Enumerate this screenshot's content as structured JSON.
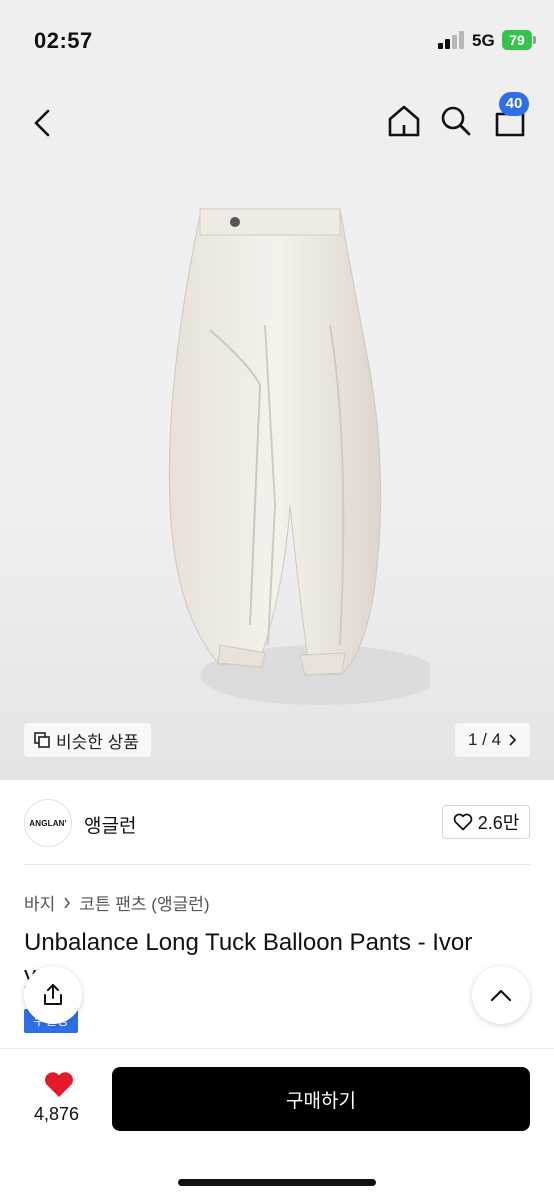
{
  "status": {
    "time": "02:57",
    "network": "5G",
    "battery": "79"
  },
  "nav": {
    "cart_count": "40"
  },
  "gallery": {
    "similar_label": "비슷한 상품",
    "pager": "1 / 4"
  },
  "brand": {
    "logo_text": "ANGLAN'",
    "name": "앵글런",
    "likes": "2.6만"
  },
  "breadcrumb": {
    "category": "바지",
    "subcategory": "코튼 팬츠 (앵글런)"
  },
  "product": {
    "title": "Unbalance Long Tuck Balloon Pants - Ivor",
    "title_wrap": "y",
    "tag": "무진장"
  },
  "bottom": {
    "wish_count": "4,876",
    "buy_label": "구매하기"
  },
  "colors": {
    "accent": "#2f6fe6",
    "wish": "#e5192c",
    "buy_bg": "#000000",
    "battery": "#37c24a"
  }
}
